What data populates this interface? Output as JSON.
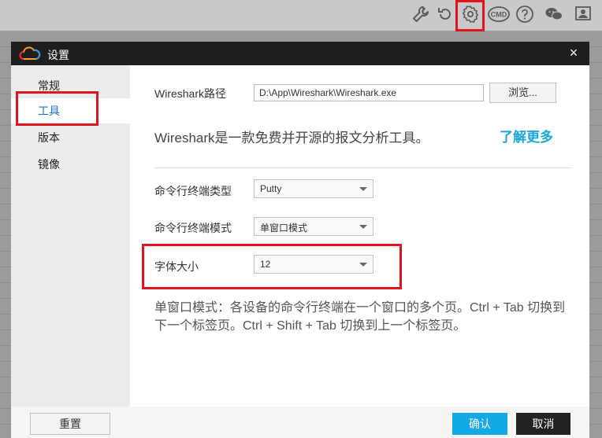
{
  "dialog": {
    "title": "设置",
    "close_symbol": "×"
  },
  "toolbar_icons": [
    "wrench-icon",
    "refresh-icon",
    "settings-gear-icon",
    "cmd-icon",
    "help-icon",
    "wechat-icon",
    "user-icon"
  ],
  "toolbar": {
    "cmd_label": "CMD"
  },
  "sidebar": {
    "items": [
      {
        "label": "常规"
      },
      {
        "label": "工具"
      },
      {
        "label": "版本"
      },
      {
        "label": "镜像"
      }
    ],
    "active_index": 1
  },
  "tools": {
    "wireshark_path_label": "Wireshark路径",
    "wireshark_path_value": "D:\\App\\Wireshark\\Wireshark.exe",
    "browse_label": "浏览...",
    "description": "Wireshark是一款免费并开源的报文分析工具。",
    "learn_more": "了解更多",
    "terminal_type_label": "命令行终端类型",
    "terminal_type_value": "Putty",
    "terminal_mode_label": "命令行终端模式",
    "terminal_mode_value": "单窗口模式",
    "font_size_label": "字体大小",
    "font_size_value": "12",
    "note": "单窗口模式：各设备的命令行终端在一个窗口的多个页。Ctrl + Tab 切换到下一个标签页。Ctrl + Shift + Tab 切换到上一个标签页。"
  },
  "footer": {
    "reset_label": "重置",
    "ok_label": "确认",
    "cancel_label": "取消"
  },
  "colors": {
    "accent": "#12a9e6",
    "highlight": "#e0141e",
    "titlebar": "#1e1e1e"
  }
}
